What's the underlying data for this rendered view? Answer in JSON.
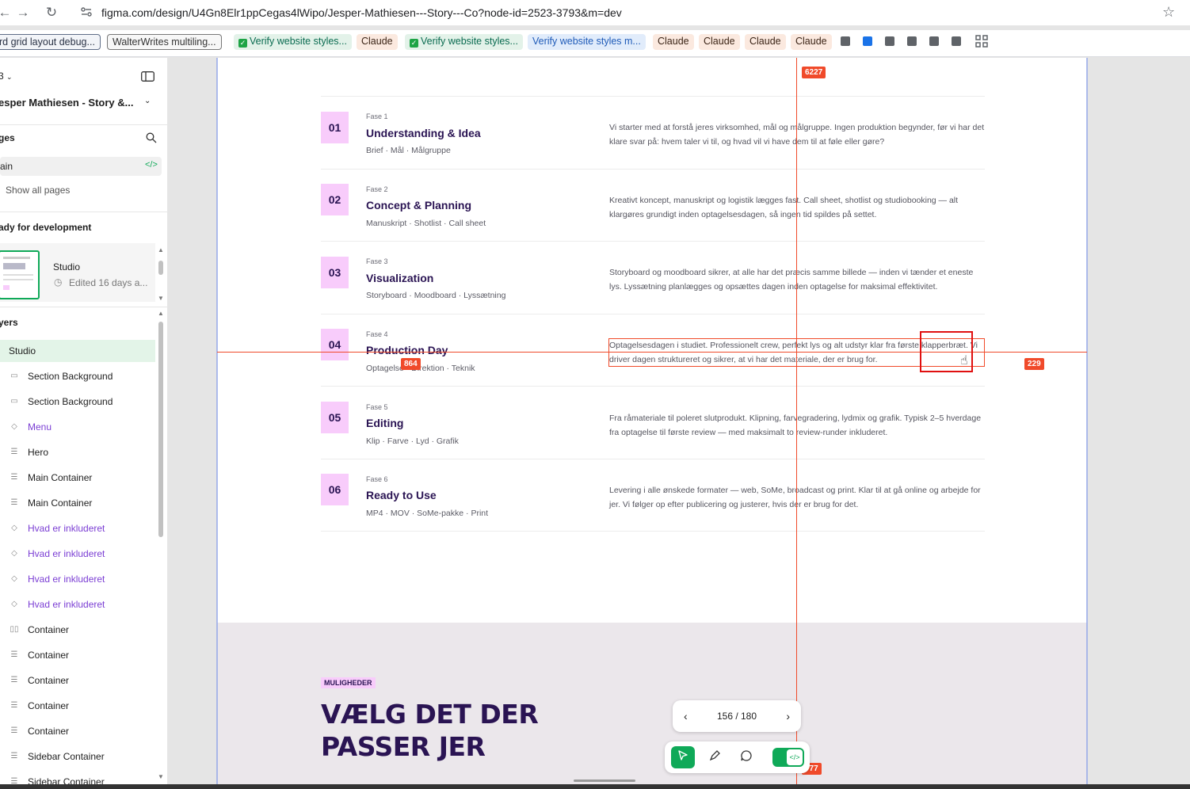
{
  "browser": {
    "url": "figma.com/design/U4Gn8Elr1ppCegas4lWipo/Jesper-Mathiesen---Story---Co?node-id=2523-3793&m=dev",
    "back_icon": "arrow-left-icon",
    "forward_icon": "arrow-right-icon",
    "reload_icon": "reload-icon",
    "star_icon": "star-icon",
    "bookmarks": [
      "rd grid layout debug...",
      "WalterWrites multiling...",
      "Verify website styles...",
      "Claude",
      "Verify website styles...",
      "Verify website styles m...",
      "Claude",
      "Claude",
      "Claude",
      "Claude"
    ]
  },
  "sidebar": {
    "file_menu": "3",
    "project_name": "esper Mathiesen - Story &...",
    "pages_label": "ges",
    "current_page": "ain",
    "show_all_pages": "Show all pages",
    "ready_heading": "ady for development",
    "studio_card": {
      "name": "Studio",
      "edited": "Edited 16 days a..."
    },
    "layers_heading": "yers",
    "layers": [
      {
        "label": "Studio",
        "type": "frame",
        "selected": true
      },
      {
        "label": "Section Background",
        "type": "rect"
      },
      {
        "label": "Section Background",
        "type": "rect"
      },
      {
        "label": "Menu",
        "type": "component"
      },
      {
        "label": "Hero",
        "type": "autolayout"
      },
      {
        "label": "Main Container",
        "type": "autolayout"
      },
      {
        "label": "Main Container",
        "type": "autolayout"
      },
      {
        "label": "Hvad er inkluderet",
        "type": "component"
      },
      {
        "label": "Hvad er inkluderet",
        "type": "component"
      },
      {
        "label": "Hvad er inkluderet",
        "type": "component"
      },
      {
        "label": "Hvad er inkluderet",
        "type": "component"
      },
      {
        "label": "Container",
        "type": "autolayout-h"
      },
      {
        "label": "Container",
        "type": "autolayout"
      },
      {
        "label": "Container",
        "type": "autolayout"
      },
      {
        "label": "Container",
        "type": "autolayout"
      },
      {
        "label": "Container",
        "type": "autolayout"
      },
      {
        "label": "Sidebar Container",
        "type": "autolayout"
      },
      {
        "label": "Sidebar Container",
        "type": "autolayout"
      }
    ]
  },
  "phases": [
    {
      "num": "01",
      "fase": "Fase 1",
      "title": "Understanding & Idea",
      "tags": "Brief · Mål · Målgruppe",
      "desc": "Vi starter med at forstå jeres virksomhed, mål og målgruppe. Ingen produktion begynder, før vi har det klare svar på: hvem taler vi til, og hvad vil vi have dem til at føle eller gøre?"
    },
    {
      "num": "02",
      "fase": "Fase 2",
      "title": "Concept & Planning",
      "tags": "Manuskript · Shotlist · Call sheet",
      "desc": "Kreativt koncept, manuskript og logistik lægges fast. Call sheet, shotlist og studiobooking — alt klargøres grundigt inden optagelsesdagen, så ingen tid spildes på settet."
    },
    {
      "num": "03",
      "fase": "Fase 3",
      "title": "Visualization",
      "tags": "Storyboard · Moodboard · Lyssætning",
      "desc": "Storyboard og moodboard sikrer, at alle har det præcis samme billede — inden vi tænder et eneste lys. Lyssætning planlægges og opsættes dagen inden optagelse for maksimal effektivitet."
    },
    {
      "num": "04",
      "fase": "Fase 4",
      "title": "Production Day",
      "tags": "Optagelse · Direktion · Teknik",
      "desc": "Optagelsesdagen i studiet. Professionelt crew, perfekt lys og alt udstyr klar fra første klapperbræt. Vi driver dagen struktureret og sikrer, at vi har det materiale, der er brug for."
    },
    {
      "num": "05",
      "fase": "Fase 5",
      "title": "Editing",
      "tags": "Klip · Farve · Lyd · Grafik",
      "desc": "Fra råmateriale til poleret slutprodukt. Klipning, farvegradering, lydmix og grafik. Typisk 2–5 hverdage fra optagelse til første review — med maksimalt to review-runder inkluderet."
    },
    {
      "num": "06",
      "fase": "Fase 6",
      "title": "Ready to Use",
      "tags": "MP4 · MOV · SoMe-pakke · Print",
      "desc": "Levering i alle ønskede formater — web, SoMe, broadcast og print. Klar til at gå online og arbejde for jer. Vi følger op efter publicering og justerer, hvis der er brug for det."
    }
  ],
  "section2": {
    "tag": "MULIGHEDER",
    "heading_line1": "VÆLG DET DER",
    "heading_line2": "PASSER JER"
  },
  "measurements": {
    "top": "6227",
    "left": "864",
    "right": "229",
    "bottom": "777"
  },
  "pager": {
    "label": "156 / 180",
    "prev_icon": "chevron-left-icon",
    "next_icon": "chevron-right-icon"
  },
  "toolbar": {
    "tools": [
      "move-icon",
      "pen-icon",
      "comment-icon",
      "dev-mode-icon"
    ]
  }
}
